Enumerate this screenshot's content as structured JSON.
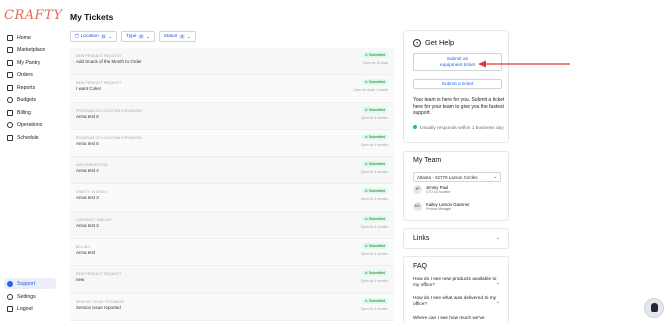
{
  "brand": {
    "logo": "CRAFTY"
  },
  "sidebar": {
    "items": [
      {
        "label": "Home"
      },
      {
        "label": "Marketplace"
      },
      {
        "label": "My Pantry"
      },
      {
        "label": "Orders"
      },
      {
        "label": "Reports"
      },
      {
        "label": "Budgets"
      },
      {
        "label": "Billing"
      },
      {
        "label": "Operations"
      },
      {
        "label": "Schedule"
      }
    ],
    "bottom": [
      {
        "label": "Support",
        "active": true
      },
      {
        "label": "Settings"
      },
      {
        "label": "Logout"
      }
    ]
  },
  "main": {
    "title": "My Tickets",
    "filters": [
      {
        "label": "Location",
        "count": "0"
      },
      {
        "label": "Type",
        "count": "0"
      },
      {
        "label": "Status",
        "count": "0"
      }
    ],
    "tickets": [
      {
        "category": "NEW PRODUCT REQUEST",
        "name": "Add Snack of the Month to Order",
        "status": "Submitted",
        "open": "Open for 15 days"
      },
      {
        "category": "NEW PRODUCT REQUEST",
        "name": "I want Coke!",
        "status": "Submitted",
        "open": "Open for about 1 month"
      },
      {
        "category": "PROGRAM OR LOCATION EXPANSION",
        "name": "Anna test 6",
        "status": "Submitted",
        "open": "Open for 3 months"
      },
      {
        "category": "PROGRAM OR LOCATION EXPANSION",
        "name": "Anna test 5",
        "status": "Submitted",
        "open": "Open for 3 months"
      },
      {
        "category": "IMPLEMENTATION",
        "name": "Anna test 4",
        "status": "Submitted",
        "open": "Open for 3 months"
      },
      {
        "category": "CRAFTY IN A BOX",
        "name": "Anna test 3",
        "status": "Submitted",
        "open": "Open for 3 months"
      },
      {
        "category": "CONTRACT INQUIRY",
        "name": "Anna test 2",
        "status": "Submitted",
        "open": "Open for 3 months"
      },
      {
        "category": "BILLING",
        "name": "Anna test",
        "status": "Submitted",
        "open": "Open for 3 months"
      },
      {
        "category": "NEW PRODUCT REQUEST",
        "name": "new",
        "status": "Submitted",
        "open": "Open for 3 months"
      },
      {
        "category": "SERVICE LEVEL FEEDBACK",
        "name": "Service issue reported",
        "status": "Submitted",
        "open": "Open for 3 months"
      }
    ]
  },
  "help": {
    "title": "Get Help",
    "equipment_button_line1": "Submit an",
    "equipment_button_line2": "equipment ticket",
    "submit_button": "Submit a ticket",
    "body": "Your team is here for you. Submit a ticket here for your team to give you the fastest support.",
    "response": "Usually responds within 1 business day"
  },
  "team": {
    "title": "My Team",
    "location": "Atlanta - 32779 Larson Circles",
    "members": [
      {
        "initials": "JP",
        "name": "Jimmy Paul",
        "role": "CTO Co-founder"
      },
      {
        "initials": "KG",
        "name": "Kailey Larson Gassner",
        "role": "Product Manager"
      }
    ]
  },
  "links": {
    "title": "Links"
  },
  "faq": {
    "title": "FAQ",
    "questions": [
      "How do I see new products available to my office?",
      "How do I see what was delivered to my office?",
      "Where can I see how much we've"
    ]
  },
  "colors": {
    "accent": "#2563eb",
    "annotation_arrow": "#e53935",
    "submitted_bg": "#dcfce7"
  }
}
